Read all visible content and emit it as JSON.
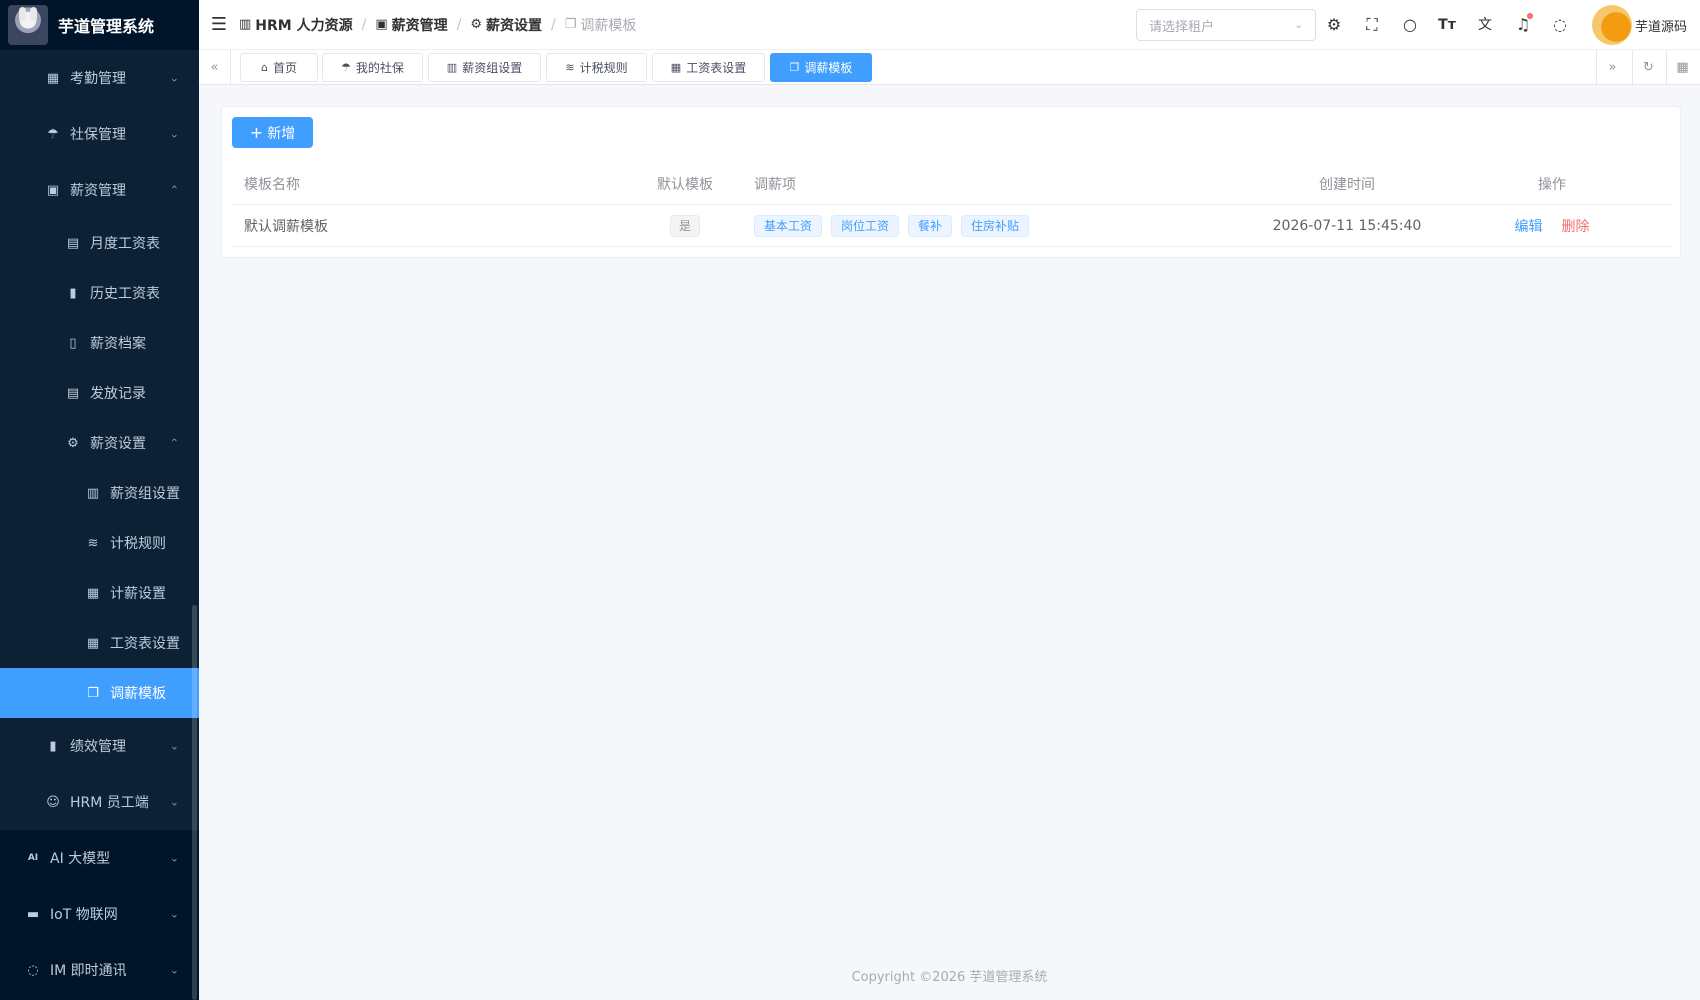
{
  "app": {
    "title": "芋道管理系统"
  },
  "sidebar": {
    "items": [
      {
        "label": "考勤管理",
        "icon": "calendar-icon"
      },
      {
        "label": "社保管理",
        "icon": "umbrella-icon"
      },
      {
        "label": "薪资管理",
        "icon": "money-icon"
      },
      {
        "label": "月度工资表",
        "icon": "document-icon"
      },
      {
        "label": "历史工资表",
        "icon": "bar-chart-icon"
      },
      {
        "label": "薪资档案",
        "icon": "archive-icon"
      },
      {
        "label": "发放记录",
        "icon": "record-icon"
      },
      {
        "label": "薪资设置",
        "icon": "gear-icon"
      },
      {
        "label": "薪资组设置",
        "icon": "building-icon"
      },
      {
        "label": "计税规则",
        "icon": "database-icon"
      },
      {
        "label": "计薪设置",
        "icon": "calendar-icon"
      },
      {
        "label": "工资表设置",
        "icon": "grid-icon"
      },
      {
        "label": "调薪模板",
        "icon": "copy-icon"
      },
      {
        "label": "绩效管理",
        "icon": "bar-chart-icon"
      },
      {
        "label": "HRM 员工端",
        "icon": "user-icon"
      },
      {
        "label": "AI 大模型",
        "icon": "ai-icon"
      },
      {
        "label": "IoT 物联网",
        "icon": "car-icon"
      },
      {
        "label": "IM 即时通讯",
        "icon": "chat-icon"
      }
    ]
  },
  "header": {
    "breadcrumb": [
      {
        "label": "HRM 人力资源",
        "icon": "building-icon"
      },
      {
        "label": "薪资管理",
        "icon": "money-icon"
      },
      {
        "label": "薪资设置",
        "icon": "gear-icon"
      },
      {
        "label": "调薪模板",
        "icon": "copy-icon"
      }
    ],
    "tenant_placeholder": "请选择租户",
    "user_name": "芋道源码"
  },
  "tags": [
    {
      "label": "首页",
      "icon": "home-icon"
    },
    {
      "label": "我的社保",
      "icon": "umbrella-icon"
    },
    {
      "label": "薪资组设置",
      "icon": "building-icon"
    },
    {
      "label": "计税规则",
      "icon": "database-icon"
    },
    {
      "label": "工资表设置",
      "icon": "grid-icon"
    },
    {
      "label": "调薪模板",
      "icon": "copy-icon"
    }
  ],
  "toolbar": {
    "add_label": "新增"
  },
  "table": {
    "columns": [
      "模板名称",
      "默认模板",
      "调薪项",
      "创建时间",
      "操作"
    ],
    "rows": [
      {
        "name": "默认调薪模板",
        "is_default": "是",
        "items": [
          "基本工资",
          "岗位工资",
          "餐补",
          "住房补贴"
        ],
        "created": "2026-07-11 15:45:40",
        "edit": "编辑",
        "delete": "删除"
      }
    ]
  },
  "footer": {
    "copyright": "Copyright ©2026 芋道管理系统"
  },
  "colors": {
    "primary": "#409eff",
    "sidebar": "#001529",
    "danger": "#f56c6c"
  }
}
